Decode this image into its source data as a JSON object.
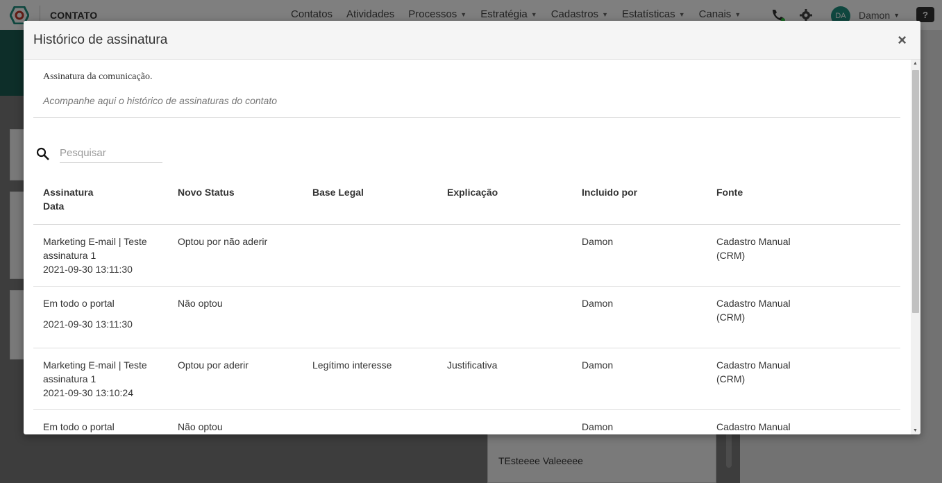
{
  "app": {
    "title": "CONTATO",
    "nav": [
      {
        "label": "Contatos",
        "dropdown": false
      },
      {
        "label": "Atividades",
        "dropdown": false
      },
      {
        "label": "Processos",
        "dropdown": true
      },
      {
        "label": "Estratégia",
        "dropdown": true
      },
      {
        "label": "Cadastros",
        "dropdown": true
      },
      {
        "label": "Estatísticas",
        "dropdown": true
      },
      {
        "label": "Canais",
        "dropdown": true
      }
    ],
    "user": {
      "initials": "DA",
      "name": "Damon"
    },
    "help": "?",
    "brand_color": "#1e8e7e",
    "background_list_item": "TEsteeee Valeeeee"
  },
  "modal": {
    "title": "Histórico de assinatura",
    "close": "×",
    "intro_title": "Assinatura da comunicação.",
    "intro_subtitle": "Acompanhe aqui o histórico de assinaturas do contato",
    "search_placeholder": "Pesquisar",
    "table": {
      "headers": {
        "signature": "Assinatura",
        "date": "Data",
        "status": "Novo Status",
        "legal": "Base Legal",
        "explanation": "Explicação",
        "included_by": "Incluido por",
        "source": "Fonte"
      },
      "rows": [
        {
          "signature": "Marketing E-mail | Teste assinatura 1",
          "date": "2021-09-30 13:11:30",
          "status": "Optou por não aderir",
          "legal": "",
          "explanation": "",
          "included_by": "Damon",
          "source": "Cadastro Manual (CRM)"
        },
        {
          "signature": "Em todo o portal",
          "date": "2021-09-30 13:11:30",
          "status": "Não optou",
          "legal": "",
          "explanation": "",
          "included_by": "Damon",
          "source": "Cadastro Manual (CRM)"
        },
        {
          "signature": "Marketing E-mail | Teste assinatura 1",
          "date": "2021-09-30 13:10:24",
          "status": "Optou por aderir",
          "legal": "Legítimo interesse",
          "explanation": "Justificativa",
          "included_by": "Damon",
          "source": "Cadastro Manual (CRM)"
        },
        {
          "signature": "Em todo o portal",
          "date": "",
          "status": "Não optou",
          "legal": "",
          "explanation": "",
          "included_by": "Damon",
          "source": "Cadastro Manual"
        }
      ]
    }
  }
}
